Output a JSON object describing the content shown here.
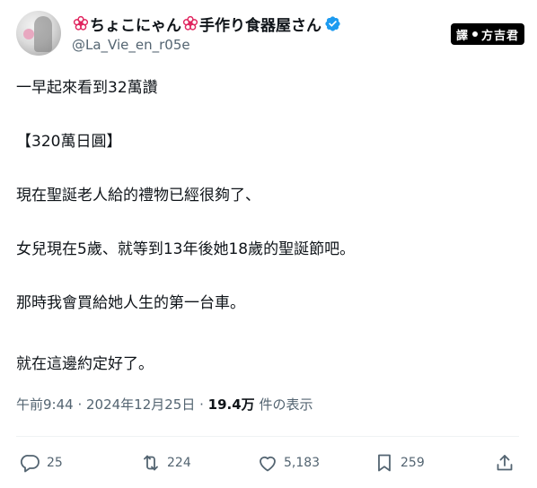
{
  "author": {
    "name": "ちょこにゃん",
    "name_suffix": "手作り食器屋さん",
    "handle": "@La_Vie_en_r05e"
  },
  "translator_badge": {
    "left": "譯",
    "right": "方吉君"
  },
  "tweet": {
    "lines": [
      "一早起來看到32萬讚",
      "【320萬日圓】",
      "現在聖誕老人給的禮物已經很夠了、",
      "女兒現在5歲、就等到13年後她18歲的聖誕節吧。",
      "那時我會買給她人生的第一台車。",
      "就在這邊約定好了。"
    ]
  },
  "meta": {
    "time": "午前9:44",
    "sep1": " · ",
    "date": "2024年12月25日",
    "sep2": " · ",
    "views_count": "19.4万",
    "views_label": " 件の表示"
  },
  "actions": {
    "reply_count": "25",
    "retweet_count": "224",
    "like_count": "5,183",
    "bookmark_count": "259"
  },
  "colors": {
    "text": "#0f1419",
    "muted": "#536471",
    "verified": "#1d9bf0",
    "blossom": "#e0245e"
  }
}
